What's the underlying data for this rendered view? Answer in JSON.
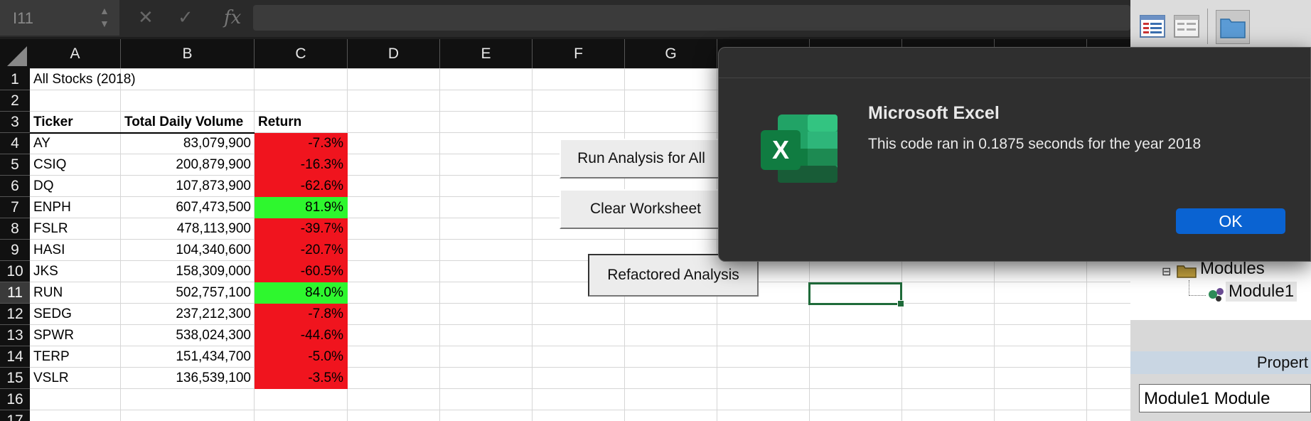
{
  "formula_bar": {
    "name_box": "I11",
    "fx_label": "fx",
    "formula": ""
  },
  "grid": {
    "columns": [
      "A",
      "B",
      "C",
      "D",
      "E",
      "F",
      "G"
    ],
    "rows": [
      "1",
      "2",
      "3",
      "4",
      "5",
      "6",
      "7",
      "8",
      "9",
      "10",
      "11",
      "12",
      "13",
      "14",
      "15",
      "16",
      "17"
    ],
    "selected_row": "11",
    "a1": "All Stocks (2018)",
    "headers": {
      "ticker": "Ticker",
      "volume": "Total Daily Volume",
      "return": "Return"
    },
    "data": [
      {
        "ticker": "AY",
        "volume": "83,079,900",
        "return": "-7.3%",
        "positive": false
      },
      {
        "ticker": "CSIQ",
        "volume": "200,879,900",
        "return": "-16.3%",
        "positive": false
      },
      {
        "ticker": "DQ",
        "volume": "107,873,900",
        "return": "-62.6%",
        "positive": false
      },
      {
        "ticker": "ENPH",
        "volume": "607,473,500",
        "return": "81.9%",
        "positive": true
      },
      {
        "ticker": "FSLR",
        "volume": "478,113,900",
        "return": "-39.7%",
        "positive": false
      },
      {
        "ticker": "HASI",
        "volume": "104,340,600",
        "return": "-20.7%",
        "positive": false
      },
      {
        "ticker": "JKS",
        "volume": "158,309,000",
        "return": "-60.5%",
        "positive": false
      },
      {
        "ticker": "RUN",
        "volume": "502,757,100",
        "return": "84.0%",
        "positive": true
      },
      {
        "ticker": "SEDG",
        "volume": "237,212,300",
        "return": "-7.8%",
        "positive": false
      },
      {
        "ticker": "SPWR",
        "volume": "538,024,300",
        "return": "-44.6%",
        "positive": false
      },
      {
        "ticker": "TERP",
        "volume": "151,434,700",
        "return": "-5.0%",
        "positive": false
      },
      {
        "ticker": "VSLR",
        "volume": "136,539,100",
        "return": "-3.5%",
        "positive": false
      }
    ],
    "colors": {
      "negative": "#f0141e",
      "positive": "#2ef72e"
    }
  },
  "buttons": {
    "run_all": "Run Analysis for All",
    "clear": "Clear Worksheet",
    "refactored": "Refactored Analysis"
  },
  "vba": {
    "modules_label": "Modules",
    "module_item": "Module1",
    "properties_title": "Propert",
    "properties_value": "Module1 Module"
  },
  "dialog": {
    "title": "Microsoft Excel",
    "message": "This code ran in 0.1875 seconds for the year 2018",
    "ok": "OK",
    "logo_letter": "X"
  }
}
